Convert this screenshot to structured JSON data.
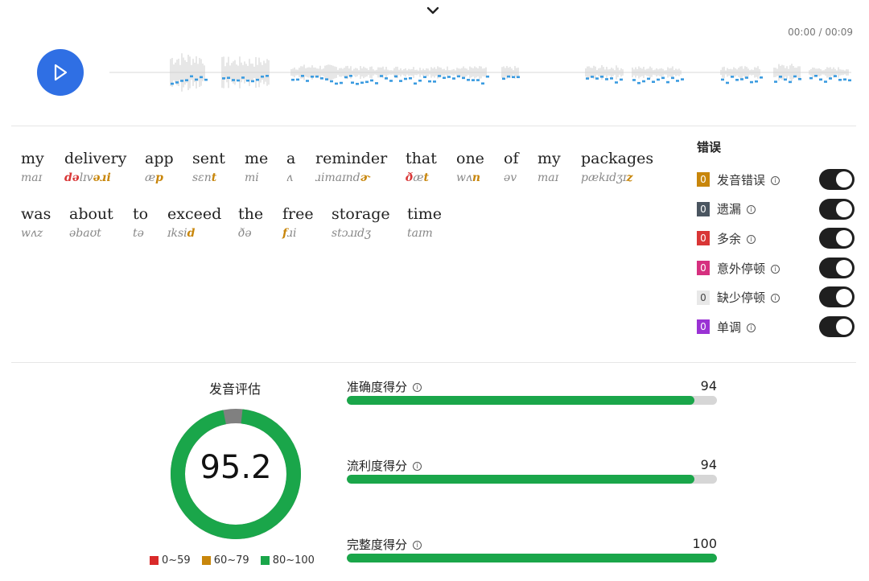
{
  "player": {
    "time": "00:00 / 00:09",
    "icons": {
      "collapse": "chevron-down-icon",
      "play": "play-icon"
    }
  },
  "sentence": {
    "line1": [
      {
        "word": "my",
        "ipa": [
          {
            "t": "maɪ"
          }
        ]
      },
      {
        "word": "delivery",
        "ipa": [
          {
            "t": "də",
            "c": "ext"
          },
          {
            "t": "lɪv"
          },
          {
            "t": "əɹi",
            "c": "err"
          }
        ]
      },
      {
        "word": "app",
        "ipa": [
          {
            "t": "æ"
          },
          {
            "t": "p",
            "c": "err"
          }
        ]
      },
      {
        "word": "sent",
        "ipa": [
          {
            "t": "sɛn"
          },
          {
            "t": "t",
            "c": "err"
          }
        ]
      },
      {
        "word": "me",
        "ipa": [
          {
            "t": "mi"
          }
        ]
      },
      {
        "word": "a",
        "ipa": [
          {
            "t": "ʌ"
          }
        ]
      },
      {
        "word": "reminder",
        "ipa": [
          {
            "t": "ɹimaɪnd"
          },
          {
            "t": "ɚ",
            "c": "err"
          }
        ]
      },
      {
        "word": "that",
        "ipa": [
          {
            "t": "ð",
            "c": "ext"
          },
          {
            "t": "æ"
          },
          {
            "t": "t",
            "c": "err"
          }
        ]
      },
      {
        "word": "one",
        "ipa": [
          {
            "t": "wʌ"
          },
          {
            "t": "n",
            "c": "err"
          }
        ]
      },
      {
        "word": "of",
        "ipa": [
          {
            "t": "əv"
          }
        ]
      },
      {
        "word": "my",
        "ipa": [
          {
            "t": "maɪ"
          }
        ]
      },
      {
        "word": "packages",
        "ipa": [
          {
            "t": "pækɪdʒɪ"
          },
          {
            "t": "z",
            "c": "err"
          }
        ]
      }
    ],
    "line2": [
      {
        "word": "was",
        "ipa": [
          {
            "t": "wʌz"
          }
        ]
      },
      {
        "word": "about",
        "ipa": [
          {
            "t": "əbaʊt"
          }
        ]
      },
      {
        "word": "to",
        "ipa": [
          {
            "t": "tə"
          }
        ]
      },
      {
        "word": "exceed",
        "ipa": [
          {
            "t": "ɪksi"
          },
          {
            "t": "d",
            "c": "err"
          }
        ]
      },
      {
        "word": "the",
        "ipa": [
          {
            "t": "ðə"
          }
        ]
      },
      {
        "word": "free",
        "ipa": [
          {
            "t": "f",
            "c": "err"
          },
          {
            "t": "ɹi"
          }
        ]
      },
      {
        "word": "storage",
        "ipa": [
          {
            "t": "stɔɹɪdʒ"
          }
        ]
      },
      {
        "word": "time",
        "ipa": [
          {
            "t": "taɪm"
          }
        ]
      }
    ]
  },
  "errors": {
    "title": "错误",
    "info_glyph": "i",
    "items": [
      {
        "count": "0",
        "label": "发音错误",
        "color": "#c8860b"
      },
      {
        "count": "0",
        "label": "遗漏",
        "color": "#4a5560"
      },
      {
        "count": "0",
        "label": "多余",
        "color": "#d93636"
      },
      {
        "count": "0",
        "label": "意外停顿",
        "color": "#d6307f"
      },
      {
        "count": "0",
        "label": "缺少停顿",
        "color": "#e8e8e8",
        "text_color": "#444"
      },
      {
        "count": "0",
        "label": "单调",
        "color": "#9a32d4"
      }
    ]
  },
  "assessment": {
    "title": "发音评估",
    "score": "95.2",
    "score_value": 95.2,
    "ring_color": "#1aa64a",
    "ring_rest_color": "#808080",
    "legend": [
      {
        "label": "0~59",
        "color": "#d92a2a"
      },
      {
        "label": "60~79",
        "color": "#c8860b"
      },
      {
        "label": "80~100",
        "color": "#1aa64a"
      }
    ]
  },
  "metrics": [
    {
      "label": "准确度得分",
      "value": "94",
      "fraction": 0.94
    },
    {
      "label": "流利度得分",
      "value": "94",
      "fraction": 0.94
    },
    {
      "label": "完整度得分",
      "value": "100",
      "fraction": 1.0
    }
  ]
}
